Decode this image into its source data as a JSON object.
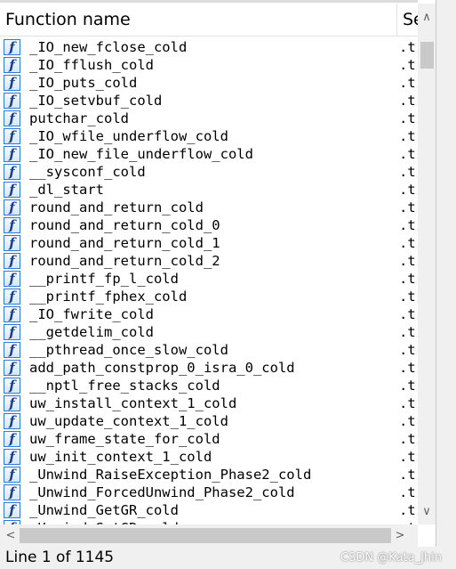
{
  "table": {
    "columns": [
      "Function name",
      "Segment"
    ],
    "column_header_name": "Function name",
    "column_header_segment": "Se",
    "icon": "function-icon",
    "icon_glyph": "f",
    "rows": [
      {
        "name": "_IO_new_fclose_cold",
        "segment": ".t"
      },
      {
        "name": "_IO_fflush_cold",
        "segment": ".t"
      },
      {
        "name": "_IO_puts_cold",
        "segment": ".t"
      },
      {
        "name": "_IO_setvbuf_cold",
        "segment": ".t"
      },
      {
        "name": "putchar_cold",
        "segment": ".t"
      },
      {
        "name": "_IO_wfile_underflow_cold",
        "segment": ".t"
      },
      {
        "name": "_IO_new_file_underflow_cold",
        "segment": ".t"
      },
      {
        "name": "__sysconf_cold",
        "segment": ".t"
      },
      {
        "name": "_dl_start",
        "segment": ".t"
      },
      {
        "name": "round_and_return_cold",
        "segment": ".t"
      },
      {
        "name": "round_and_return_cold_0",
        "segment": ".t"
      },
      {
        "name": "round_and_return_cold_1",
        "segment": ".t"
      },
      {
        "name": "round_and_return_cold_2",
        "segment": ".t"
      },
      {
        "name": "__printf_fp_l_cold",
        "segment": ".t"
      },
      {
        "name": "__printf_fphex_cold",
        "segment": ".t"
      },
      {
        "name": "_IO_fwrite_cold",
        "segment": ".t"
      },
      {
        "name": "__getdelim_cold",
        "segment": ".t"
      },
      {
        "name": "__pthread_once_slow_cold",
        "segment": ".t"
      },
      {
        "name": "add_path_constprop_0_isra_0_cold",
        "segment": ".t"
      },
      {
        "name": "__nptl_free_stacks_cold",
        "segment": ".t"
      },
      {
        "name": "uw_install_context_1_cold",
        "segment": ".t"
      },
      {
        "name": "uw_update_context_1_cold",
        "segment": ".t"
      },
      {
        "name": "uw_frame_state_for_cold",
        "segment": ".t"
      },
      {
        "name": "uw_init_context_1_cold",
        "segment": ".t"
      },
      {
        "name": "_Unwind_RaiseException_Phase2_cold",
        "segment": ".t"
      },
      {
        "name": "_Unwind_ForcedUnwind_Phase2_cold",
        "segment": ".t"
      },
      {
        "name": "_Unwind_GetGR_cold",
        "segment": ".t"
      },
      {
        "name": "_Unwind_SetGR_cold",
        "segment": ".t"
      }
    ]
  },
  "scrollbars": {
    "up_icon": "chevron-up-icon",
    "down_icon": "chevron-down-icon",
    "left_icon": "chevron-left-icon",
    "right_icon": "chevron-right-icon"
  },
  "status": {
    "text": "Line 1 of 1145"
  },
  "watermark": "CSDN @Kata_Jhin",
  "colors": {
    "icon_border": "#2e7ad6",
    "icon_glyph": "#1a3f8a",
    "scroll_thumb": "#c9c9c9",
    "window_bg": "#f0f0f0"
  }
}
